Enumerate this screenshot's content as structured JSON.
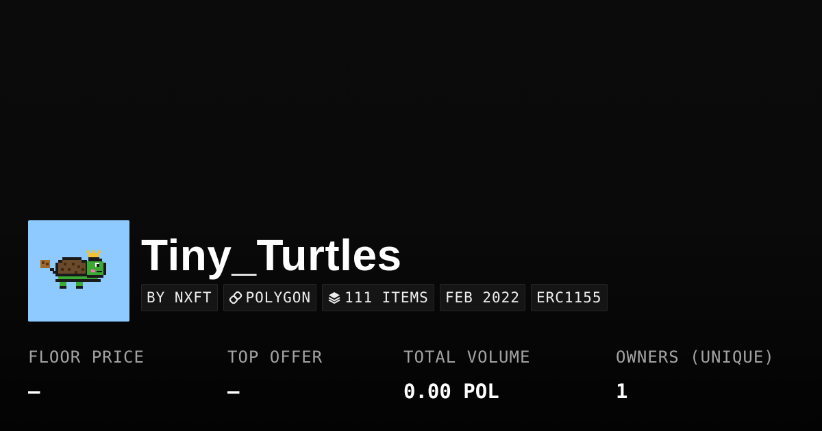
{
  "collection": {
    "name": "Tiny_Turtles",
    "avatar_background": "#8ec9ff",
    "avatar_icon": "pixel-turtle-icon"
  },
  "chips": {
    "creator": "BY NXFT",
    "chain": "POLYGON",
    "chain_icon": "link-icon",
    "items": "111 ITEMS",
    "items_icon": "layers-icon",
    "date": "FEB 2022",
    "standard": "ERC1155"
  },
  "stats": {
    "floor_price": {
      "label": "FLOOR PRICE",
      "value": "–"
    },
    "top_offer": {
      "label": "TOP OFFER",
      "value": "–"
    },
    "total_volume": {
      "label": "TOTAL VOLUME",
      "value": "0.00 POL"
    },
    "owners": {
      "label": "OWNERS (UNIQUE)",
      "value": "1"
    }
  }
}
